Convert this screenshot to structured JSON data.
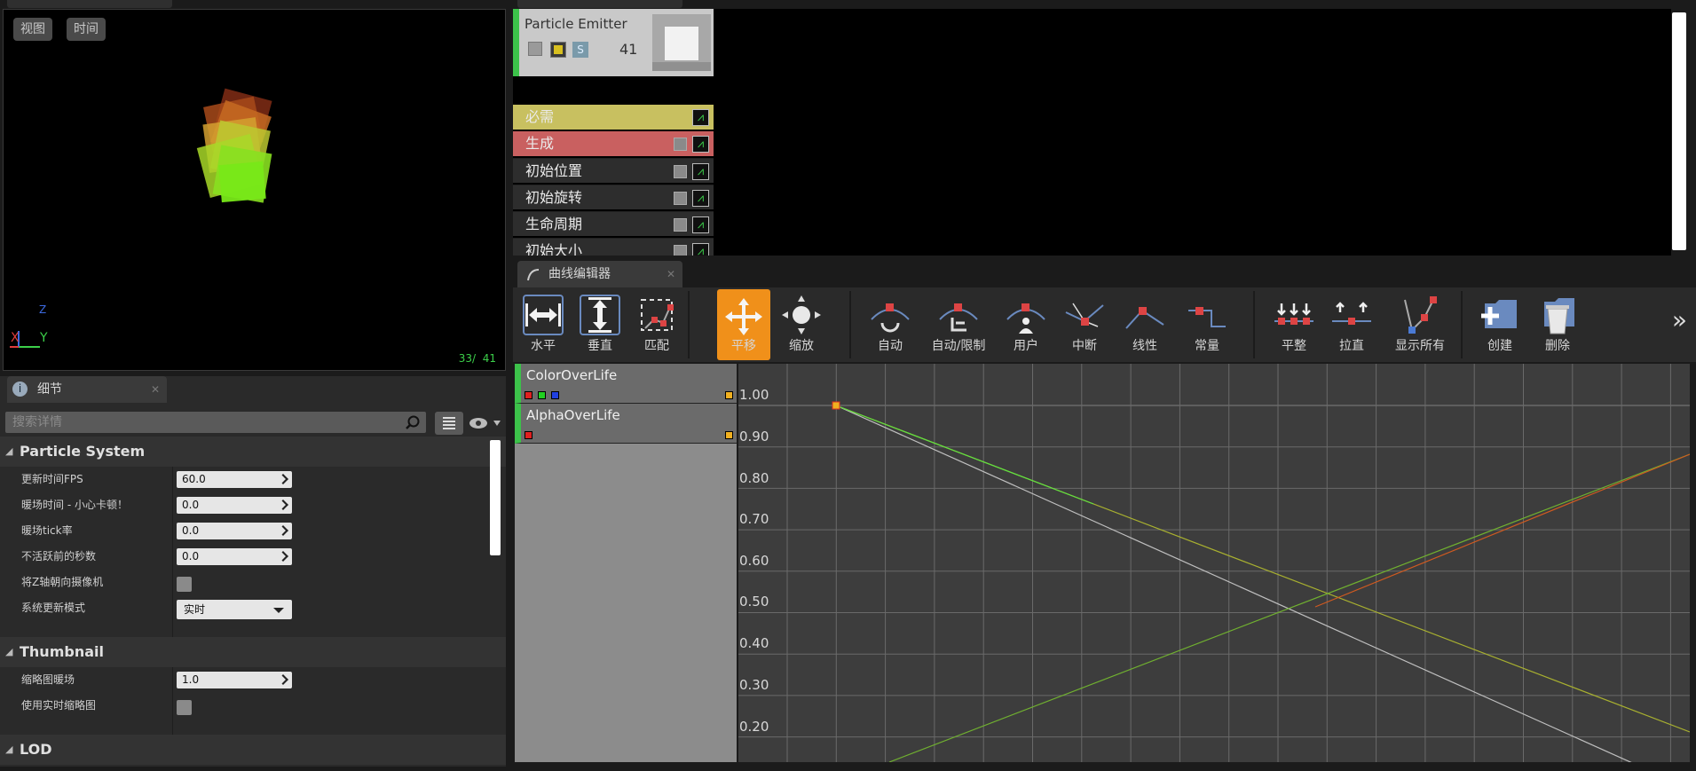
{
  "viewport": {
    "btn_view": "视图",
    "btn_time": "时间",
    "counter": "33/  41",
    "axis_x": "X",
    "axis_y": "Y",
    "axis_z": "Z"
  },
  "details": {
    "tab_label": "细节",
    "search_placeholder": "搜索详情",
    "categories": [
      {
        "name": "Particle System"
      },
      {
        "name": "Thumbnail"
      },
      {
        "name": "LOD"
      }
    ],
    "rows": [
      {
        "label": "更新时间FPS",
        "value": "60.0"
      },
      {
        "label": "暖场时间 - 小心卡顿！",
        "value": "0.0"
      },
      {
        "label": "暖场tick率",
        "value": "0.0"
      },
      {
        "label": "不活跃前的秒数",
        "value": "0.0"
      },
      {
        "label": "将Z轴朝向摄像机",
        "checked": false
      },
      {
        "label": "系统更新模式",
        "value": "实时"
      },
      {
        "label": "缩略图暖场",
        "value": "1.0"
      },
      {
        "label": "使用实时缩略图",
        "checked": false
      }
    ]
  },
  "emitter": {
    "name": "Particle Emitter",
    "count": "41",
    "badge_s": "S",
    "modules": [
      {
        "label": "必需",
        "color": "#c8c060"
      },
      {
        "label": "生成",
        "color": "#c96060"
      },
      {
        "label": "初始位置",
        "color": "#2d2d2d"
      },
      {
        "label": "初始旋转",
        "color": "#2d2d2d"
      },
      {
        "label": "生命周期",
        "color": "#2d2d2d"
      },
      {
        "label": "初始大小",
        "color": "#2d2d2d"
      }
    ]
  },
  "curve_editor": {
    "tab_label": "曲线编辑器",
    "tools": [
      {
        "label": "水平",
        "icon": "fit-horizontal-icon"
      },
      {
        "label": "垂直",
        "icon": "fit-vertical-icon"
      },
      {
        "label": "匹配",
        "icon": "fit-all-icon"
      },
      {
        "label": "平移",
        "icon": "pan-icon",
        "active": true
      },
      {
        "label": "缩放",
        "icon": "zoom-icon"
      },
      {
        "label": "自动",
        "icon": "curve-auto-icon"
      },
      {
        "label": "自动/限制",
        "icon": "curve-auto-clamped-icon"
      },
      {
        "label": "用户",
        "icon": "curve-user-icon"
      },
      {
        "label": "中断",
        "icon": "curve-break-icon"
      },
      {
        "label": "线性",
        "icon": "curve-linear-icon"
      },
      {
        "label": "常量",
        "icon": "curve-constant-icon"
      },
      {
        "label": "平整",
        "icon": "flatten-icon"
      },
      {
        "label": "拉直",
        "icon": "straighten-icon"
      },
      {
        "label": "显示所有",
        "icon": "show-all-icon"
      },
      {
        "label": "创建",
        "icon": "create-tab-icon"
      },
      {
        "label": "删除",
        "icon": "delete-tab-icon"
      }
    ],
    "overflow": "»",
    "curves": [
      {
        "name": "ColorOverLife"
      },
      {
        "name": "AlphaOverLife"
      }
    ],
    "y_ticks": [
      "1.00",
      "0.90",
      "0.80",
      "0.70",
      "0.60",
      "0.50",
      "0.40",
      "0.30",
      "0.20"
    ]
  },
  "colors": {
    "accent_orange": "#f0901a",
    "emitter_green": "#3cc24a"
  }
}
